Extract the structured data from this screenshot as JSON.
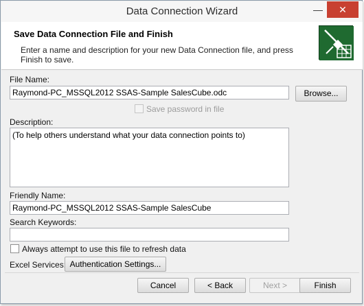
{
  "window": {
    "title": "Data Connection Wizard",
    "minimize_glyph": "—",
    "close_glyph": "✕"
  },
  "header": {
    "title": "Save Data Connection File and Finish",
    "description": "Enter a name and description for your new Data Connection file, and press Finish to save.",
    "icon": "data-connection-wizard-icon"
  },
  "form": {
    "file_name_label": "File Name:",
    "file_name_value": "Raymond-PC_MSSQL2012 SSAS-Sample SalesCube.odc",
    "browse_label": "Browse...",
    "save_password_label": "Save password in file",
    "description_label": "Description:",
    "description_value": "(To help others understand what your data connection points to)",
    "friendly_name_label": "Friendly Name:",
    "friendly_name_value": "Raymond-PC_MSSQL2012 SSAS-Sample SalesCube",
    "search_keywords_label": "Search Keywords:",
    "search_keywords_value": "",
    "always_refresh_label": "Always attempt to use this file to refresh data",
    "excel_services_label": "Excel Services:",
    "auth_settings_label": "Authentication Settings..."
  },
  "footer": {
    "cancel_label": "Cancel",
    "back_label": "< Back",
    "next_label": "Next >",
    "finish_label": "Finish"
  }
}
